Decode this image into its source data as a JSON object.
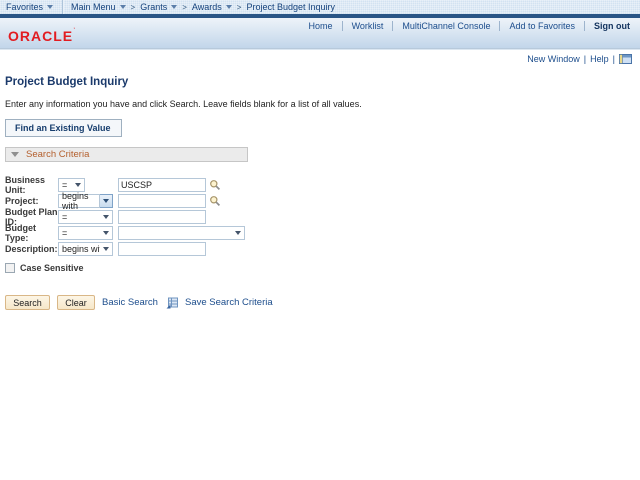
{
  "breadcrumb": {
    "favorites": "Favorites",
    "items": [
      "Main Menu",
      "Grants",
      "Awards"
    ],
    "separator": ">",
    "current": "Project Budget Inquiry"
  },
  "header": {
    "logo": "ORACLE",
    "links": [
      "Home",
      "Worklist",
      "MultiChannel Console",
      "Add to Favorites"
    ],
    "signout": "Sign out"
  },
  "utility": {
    "new_window": "New Window",
    "help": "Help",
    "divider": "|"
  },
  "page": {
    "title": "Project Budget Inquiry",
    "instructions": "Enter any information you have and click Search. Leave fields blank for a list of all values.",
    "tab": "Find an Existing Value",
    "section": "Search Criteria"
  },
  "form": {
    "rows": [
      {
        "label": "Business Unit:",
        "operator": "=",
        "value": "USCSP"
      },
      {
        "label": "Project:",
        "operator": "begins with",
        "value": ""
      },
      {
        "label": "Budget Plan ID:",
        "operator": "=",
        "value": ""
      },
      {
        "label": "Budget Type:",
        "operator": "=",
        "value": ""
      },
      {
        "label": "Description:",
        "operator": "begins with",
        "value": ""
      }
    ],
    "case_sensitive": "Case Sensitive"
  },
  "actions": {
    "search": "Search",
    "clear": "Clear",
    "basic_search": "Basic Search",
    "save_search": "Save Search Criteria"
  },
  "colors": {
    "logo_red": "#e21c21",
    "link_blue": "#1c4d8c",
    "title_navy": "#1b3a6b",
    "section_orange": "#b4602e",
    "breadcrumb_bg": "#d2e2f1",
    "navy_strip": "#2a5586",
    "button_bg": "#f6e7c9",
    "button_border": "#d9b787"
  }
}
